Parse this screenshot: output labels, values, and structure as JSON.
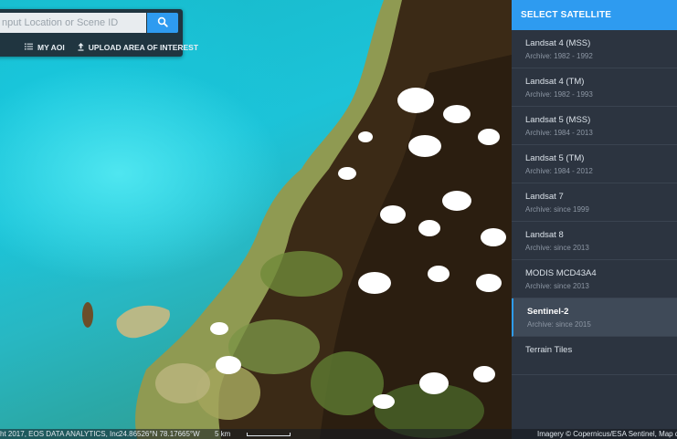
{
  "search": {
    "placeholder": "nput Location or Scene ID",
    "value": ""
  },
  "panel_actions": {
    "my_aoi": "MY AOI",
    "upload_aoi": "UPLOAD AREA OF INTEREST"
  },
  "sidebar": {
    "title": "SELECT SATELLITE",
    "items": [
      {
        "name": "Landsat 4 (MSS)",
        "archive": "Archive: 1982 - 1992",
        "active": false
      },
      {
        "name": "Landsat 4 (TM)",
        "archive": "Archive: 1982 - 1993",
        "active": false
      },
      {
        "name": "Landsat 5 (MSS)",
        "archive": "Archive: 1984 - 2013",
        "active": false
      },
      {
        "name": "Landsat 5 (TM)",
        "archive": "Archive: 1984 - 2012",
        "active": false
      },
      {
        "name": "Landsat 7",
        "archive": "Archive: since 1999",
        "active": false
      },
      {
        "name": "Landsat 8",
        "archive": "Archive: since 2013",
        "active": false
      },
      {
        "name": "MODIS MCD43A4",
        "archive": "Archive: since 2013",
        "active": false
      },
      {
        "name": "Sentinel-2",
        "archive": "Archive: since 2015",
        "active": true
      },
      {
        "name": "Terrain Tiles",
        "archive": "",
        "active": false
      }
    ]
  },
  "status_bar": {
    "copyright": "ht 2017, EOS DATA ANALYTICS, Inc",
    "coordinates": "24.86526°N 78.17665°W",
    "scale": "5 km",
    "imagery_credit": "Imagery © Copernicus/ESA Sentinel, Map data"
  },
  "colors": {
    "accent": "#2e9bf0",
    "sidebar_bg": "#2c3440",
    "active_item_bg": "#3f4a58"
  }
}
